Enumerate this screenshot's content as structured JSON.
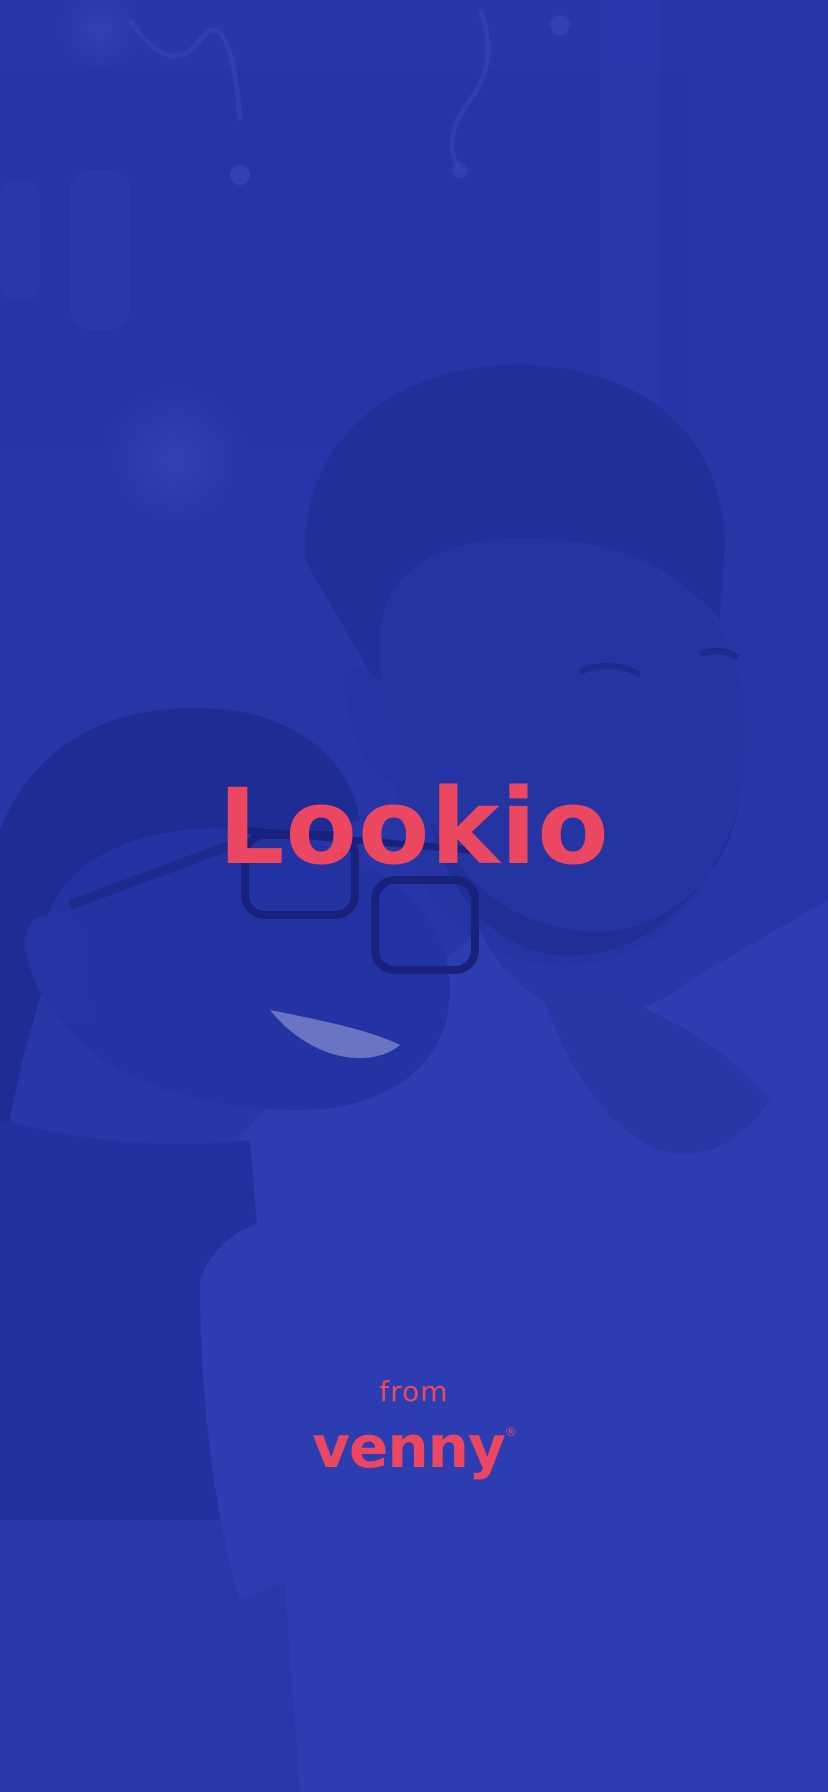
{
  "splash": {
    "app_title": "Lookio",
    "from_label": "from",
    "brand_name": "venny",
    "brand_mark": "®"
  },
  "colors": {
    "background_tint": "#2a3aa6",
    "accent": "#ec4760"
  },
  "background_image": {
    "icon": "couple-photo-icon"
  }
}
